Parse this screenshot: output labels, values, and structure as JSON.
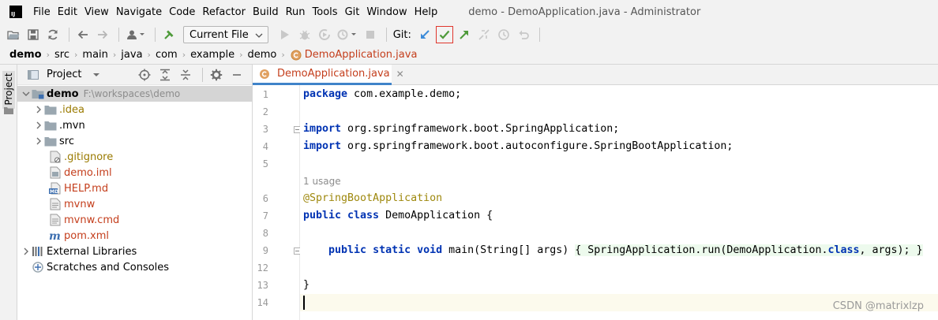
{
  "menubar": {
    "logo_text": "IJ",
    "items": [
      "File",
      "Edit",
      "View",
      "Navigate",
      "Code",
      "Refactor",
      "Build",
      "Run",
      "Tools",
      "Git",
      "Window",
      "Help"
    ],
    "window_title": "demo - DemoApplication.java - Administrator"
  },
  "toolbar": {
    "run_config": "Current File",
    "git_label": "Git:"
  },
  "breadcrumb": [
    "demo",
    "src",
    "main",
    "java",
    "com",
    "example",
    "demo",
    "DemoApplication.java"
  ],
  "sidestrip": {
    "label": "Project"
  },
  "project_panel": {
    "title": "Project",
    "tree": [
      {
        "name": "demo",
        "hint": "F:\\workspaces\\demo"
      },
      {
        "name": ".idea"
      },
      {
        "name": ".mvn"
      },
      {
        "name": "src"
      },
      {
        "name": ".gitignore"
      },
      {
        "name": "demo.iml"
      },
      {
        "name": "HELP.md"
      },
      {
        "name": "mvnw"
      },
      {
        "name": "mvnw.cmd"
      },
      {
        "name": "pom.xml"
      },
      {
        "name": "External Libraries"
      },
      {
        "name": "Scratches and Consoles"
      }
    ]
  },
  "editor": {
    "tab_label": "DemoApplication.java",
    "usage_hint": "1 usage",
    "line_numbers": [
      "1",
      "2",
      "3",
      "4",
      "5",
      "6",
      "7",
      "8",
      "9",
      "12",
      "13",
      "14"
    ],
    "code": {
      "l1_kw": "package",
      "l1_rest": " com.example.demo;",
      "l3_kw": "import",
      "l3_rest": " org.springframework.boot.SpringApplication;",
      "l4_kw": "import",
      "l4_rest": " org.springframework.boot.autoconfigure.SpringBootApplication;",
      "l6_ann": "@SpringBootApplication",
      "l7_kw": "public class",
      "l7_rest": " DemoApplication {",
      "l9_kw": "public static void",
      "l9_sig": " main(String[] args) ",
      "l9_inlay_a": "{ SpringApplication.run(DemoApplication.",
      "l9_class_kw": "class",
      "l9_inlay_b": ", args); }",
      "l13": "}"
    }
  },
  "watermark": "CSDN @matrixlzp"
}
